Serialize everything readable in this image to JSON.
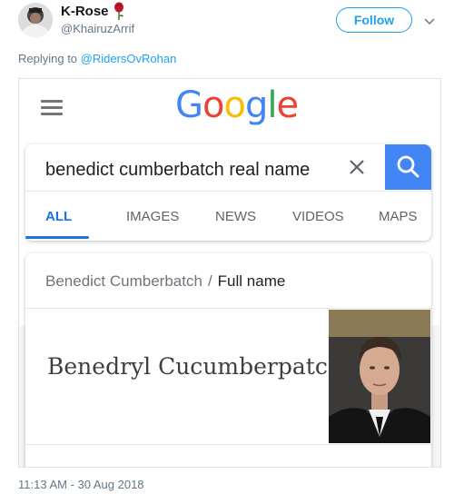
{
  "tweet": {
    "display_name": "K-Rose",
    "handle": "@KhairuzArrif",
    "follow_label": "Follow",
    "reply_prefix": "Replying to ",
    "reply_mention": "@RidersOvRohan",
    "timestamp": "11:13 AM - 30 Aug 2018"
  },
  "google": {
    "logo_letters": [
      "G",
      "o",
      "o",
      "g",
      "l",
      "e"
    ],
    "logo_colors": [
      "#4285f4",
      "#ea4335",
      "#fbbc05",
      "#4285f4",
      "#34a853",
      "#ea4335"
    ],
    "search_query": "benedict cumberbatch real name",
    "tabs": [
      {
        "label": "ALL",
        "active": true
      },
      {
        "label": "IMAGES",
        "active": false
      },
      {
        "label": "NEWS",
        "active": false
      },
      {
        "label": "VIDEOS",
        "active": false
      },
      {
        "label": "MAPS",
        "active": false
      }
    ],
    "result": {
      "entity": "Benedict Cumberbatch",
      "separator": "/",
      "field": "Full name",
      "answer": "Benedryl Cucumberpatch"
    }
  },
  "colors": {
    "twitter_blue": "#1da1f2",
    "google_blue": "#4285f4",
    "tab_active": "#1a73e8"
  },
  "icons": [
    "rose-icon",
    "chevron-down-icon",
    "hamburger-menu-icon",
    "clear-icon",
    "search-icon"
  ]
}
